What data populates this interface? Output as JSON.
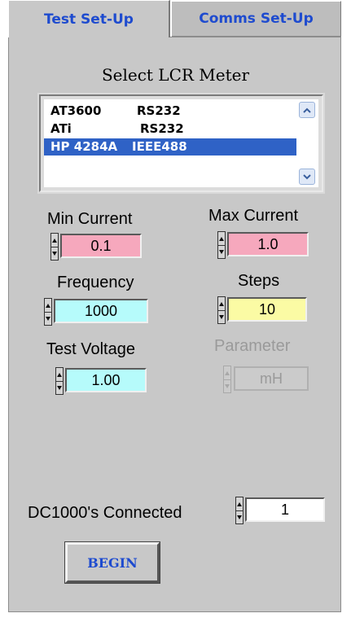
{
  "tabs": [
    {
      "label": "Test Set-Up",
      "active": true
    },
    {
      "label": "Comms Set-Up",
      "active": false
    }
  ],
  "meter_select": {
    "title": "Select LCR Meter",
    "items": [
      {
        "model": "AT3600",
        "interface": "RS232",
        "selected": false
      },
      {
        "model": "ATi",
        "interface": "RS232",
        "selected": false
      },
      {
        "model": "HP 4284A",
        "interface": "IEEE488",
        "selected": true
      }
    ]
  },
  "controls": {
    "min_current": {
      "label": "Min Current",
      "value": "0.1",
      "color": "#f6a8bd"
    },
    "max_current": {
      "label": "Max Current",
      "value": "1.0",
      "color": "#f6a8bd"
    },
    "frequency": {
      "label": "Frequency",
      "value": "1000",
      "color": "#b6fbfb"
    },
    "steps": {
      "label": "Steps",
      "value": "10",
      "color": "#fbfba4"
    },
    "test_voltage": {
      "label": "Test Voltage",
      "value": "1.00",
      "color": "#b6fbfb"
    },
    "parameter": {
      "label": "Parameter",
      "value": "mH",
      "disabled": true
    }
  },
  "dc1000": {
    "label": "DC1000's Connected",
    "value": "1",
    "color": "#ffffff"
  },
  "begin_button": {
    "label": "BEGIN"
  },
  "colors": {
    "panel": "#c8c8c8",
    "accent_text": "#1e4bcf",
    "selection": "#2f62c6"
  }
}
